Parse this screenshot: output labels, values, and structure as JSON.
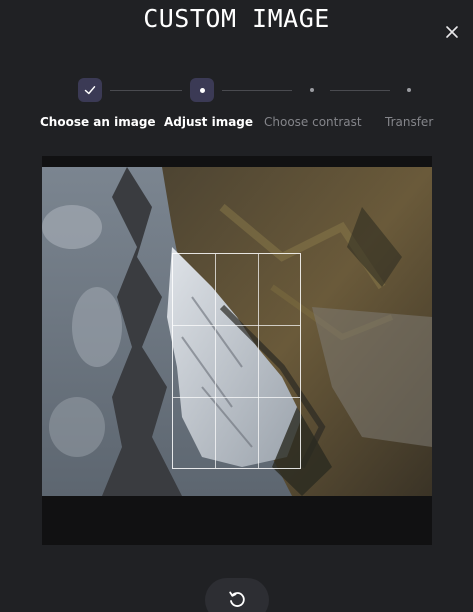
{
  "header": {
    "title": "CUSTOM IMAGE"
  },
  "close": {
    "icon": "close-icon"
  },
  "stepper": {
    "steps": [
      {
        "label": "Choose an image",
        "state": "done",
        "icon": "check-icon"
      },
      {
        "label": "Adjust image",
        "state": "active",
        "icon": "dot-icon"
      },
      {
        "label": "Choose contrast",
        "state": "pending",
        "icon": "dot-icon"
      },
      {
        "label": "Transfer",
        "state": "pending",
        "icon": "dot-icon"
      }
    ]
  },
  "editor": {
    "image_subject": "rotated mountain ridge photo",
    "crop_grid": "3x3"
  },
  "actions": {
    "reset_icon": "rotate-reset-icon"
  },
  "colors": {
    "background": "#202124",
    "step_active_bg": "#3b3a55",
    "pending_text": "#84858a"
  }
}
